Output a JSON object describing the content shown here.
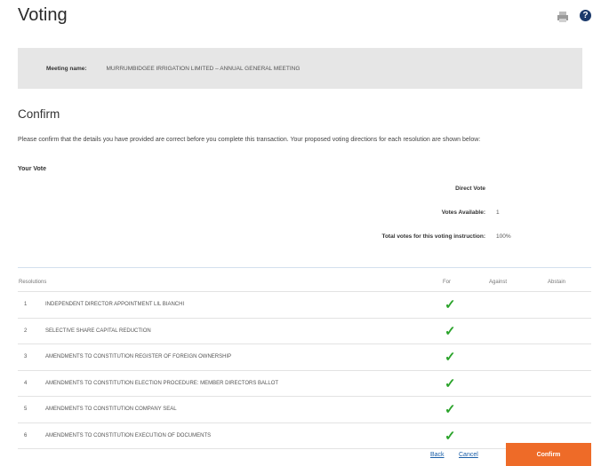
{
  "header": {
    "title": "Voting",
    "print_icon": "print-icon",
    "help_icon": "help-icon",
    "help_glyph": "?"
  },
  "meeting": {
    "label": "Meeting name:",
    "value": "MURRUMBIDGEE IRRIGATION LIMITED – ANNUAL GENERAL MEETING"
  },
  "confirm": {
    "title": "Confirm",
    "description": "Please confirm that the details you have provided are correct before you complete this transaction. Your proposed voting directions for each resolution are shown below:"
  },
  "your_vote": {
    "heading": "Your Vote",
    "direct_vote_label": "Direct Vote",
    "votes_available_label": "Votes Available:",
    "votes_available_value": "1",
    "total_votes_label": "Total votes for this voting instruction:",
    "total_votes_value": "100%"
  },
  "table": {
    "headers": {
      "resolutions": "Resolutions",
      "for": "For",
      "against": "Against",
      "abstain": "Abstain"
    },
    "rows": [
      {
        "num": "1",
        "name": "INDEPENDENT DIRECTOR APPOINTMENT LIL BIANCHI",
        "vote": "for"
      },
      {
        "num": "2",
        "name": "SELECTIVE SHARE CAPITAL REDUCTION",
        "vote": "for"
      },
      {
        "num": "3",
        "name": "AMENDMENTS TO CONSTITUTION REGISTER OF FOREIGN OWNERSHIP",
        "vote": "for"
      },
      {
        "num": "4",
        "name": "AMENDMENTS TO CONSTITUTION ELECTION PROCEDURE: MEMBER DIRECTORS BALLOT",
        "vote": "for"
      },
      {
        "num": "5",
        "name": "AMENDMENTS TO CONSTITUTION COMPANY SEAL",
        "vote": "for"
      },
      {
        "num": "6",
        "name": "AMENDMENTS TO CONSTITUTION EXECUTION OF DOCUMENTS",
        "vote": "for"
      }
    ],
    "check_glyph": "✓",
    "check_icon": "checkmark-icon"
  },
  "actions": {
    "back": "Back",
    "cancel": "Cancel",
    "confirm": "Confirm"
  },
  "colors": {
    "accent": "#ee6b28",
    "check": "#2aa32a",
    "link": "#1b5fa8",
    "band": "#e6e6e6"
  }
}
